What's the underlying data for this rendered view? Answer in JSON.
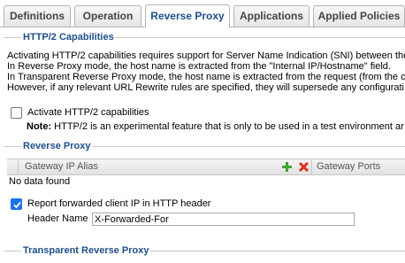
{
  "tabs": [
    {
      "label": "Definitions"
    },
    {
      "label": "Operation"
    },
    {
      "label": "Reverse Proxy"
    },
    {
      "label": "Applications"
    },
    {
      "label": "Applied Policies"
    }
  ],
  "active_tab": "Reverse Proxy",
  "http2": {
    "legend": "HTTP/2 Capabilities",
    "description": [
      "Activating HTTP/2 capabilities requires support for Server Name Indication (SNI) between the",
      "In Reverse Proxy mode, the host name is extracted from the \"Internal IP/Hostname\" field.",
      "In Transparent Reverse Proxy mode, the host name is extracted from the request (from the c",
      "However, if any relevant URL Rewrite rules are specified, they will supersede any configurati"
    ],
    "activate_label": "Activate HTTP/2 capabilities",
    "activate_checked": false,
    "note_prefix": "Note:",
    "note_text": " HTTP/2 is an experimental feature that is only to be used in a test environment ar"
  },
  "reverse_proxy": {
    "legend": "Reverse Proxy",
    "columns": [
      "Gateway IP Alias",
      "Gateway Ports"
    ],
    "empty_text": "No data found",
    "report_label": "Report forwarded client IP in HTTP header",
    "report_checked": true,
    "header_name_label": "Header Name",
    "header_name_value": "X-Forwarded-For"
  },
  "transparent": {
    "legend": "Transparent Reverse Proxy"
  },
  "colors": {
    "accent": "#1f4e8c",
    "add_icon": "#3fa535",
    "delete_icon": "#e0301e",
    "checkbox_checked": "#1a73e8"
  }
}
